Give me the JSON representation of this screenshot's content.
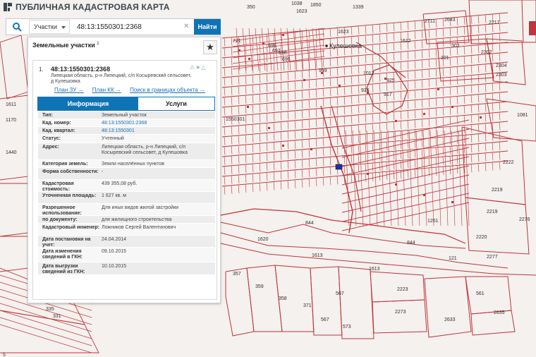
{
  "app": {
    "title": "ПУБЛИЧНАЯ КАДАСТРОВАЯ КАРТА"
  },
  "search": {
    "type": "Участки",
    "query": "48:13:1550301:2368",
    "button": "Найти",
    "icons": [
      "search-icon",
      "clear-icon"
    ]
  },
  "panel": {
    "heading": "Земельные участки",
    "count": "1",
    "item_number": "1.",
    "cad_number": "48:13:1550301:2368",
    "address": "Липецкая область, р-н Липецкий, с/п Косыревский сельсовет, д Кулешовка",
    "links": [
      "План ЗУ →",
      "План КК →",
      "Поиск в границах объекта →"
    ],
    "tabs": [
      "Информация",
      "Услуги"
    ],
    "rows": [
      {
        "k": "Тип:",
        "v": "Земельный участок"
      },
      {
        "k": "Кад. номер:",
        "v": "48:13:1550301:2368"
      },
      {
        "k": "Кад. квартал:",
        "v": "48:13:1550301"
      },
      {
        "k": "Статус:",
        "v": "Учтенный"
      },
      {
        "k": "Адрес:",
        "v": "Липецкая область, р-н Липецкий, с/п Косыревский сельсовет, д Кулешовка"
      },
      {
        "k": "Категория земель:",
        "v": "Земли населённых пунктов"
      },
      {
        "k": "Форма собственности:",
        "v": "-"
      },
      {
        "k": "Кадастровая стоимость:",
        "v": "439 355,08 руб."
      },
      {
        "k": "Уточненная площадь:",
        "v": "1 627 кв. м"
      },
      {
        "k": "Разрешенное использование:",
        "v": "Для иных видов жилой застройки"
      },
      {
        "k": "по документу:",
        "v": "для жилищного строительства"
      },
      {
        "k": "Кадастровый инженер:",
        "v": "Ложников Сергей Валентинович"
      },
      {
        "k": "Дата постановки на учет:",
        "v": "24.04.2014"
      },
      {
        "k": "Дата изменения сведений в ГКН:",
        "v": "09.10.2015"
      },
      {
        "k": "Дата выгрузки сведений из ГКН:",
        "v": "10.10.2015"
      }
    ]
  },
  "map": {
    "place_name": "Кулешовка",
    "labels": [
      "959",
      "1012",
      "926",
      "925",
      "917",
      "1550301",
      "844",
      "844",
      "1261",
      "1620",
      "1613",
      "1613",
      "121",
      "357",
      "359",
      "358",
      "371",
      "567",
      "567",
      "573",
      "2223",
      "2273",
      "2633",
      "561",
      "2635",
      "2220",
      "2277",
      "2276",
      "2219",
      "2219",
      "2222",
      "1081",
      "2711",
      "2643",
      "2217",
      "81",
      "2302",
      "2304",
      "2303",
      "302",
      "301",
      "1622",
      "1623",
      "1038",
      "1850",
      "1623",
      "1339",
      "350",
      "721",
      "699",
      "698",
      "696",
      "697",
      "1611",
      "1170",
      "1440",
      "335",
      "331",
      "5"
    ],
    "colors": {
      "parcel": "#c0343a",
      "road": "#a33",
      "highlight": "#1b2fb5",
      "ground": "#f4f1ee"
    }
  }
}
